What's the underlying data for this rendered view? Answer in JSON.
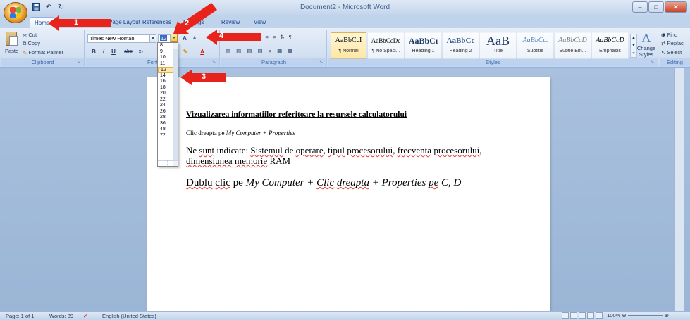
{
  "window": {
    "title": "Document2 - Microsoft Word",
    "minimize": "–",
    "maximize": "□",
    "close": "✕"
  },
  "quick_access": {
    "save_icon": "floppy-icon",
    "undo_glyph": "↶",
    "redo_glyph": "↻"
  },
  "tabs": [
    {
      "label": "Home",
      "active": true
    },
    {
      "label": "Page Layout"
    },
    {
      "label": "References"
    },
    {
      "label": "Mailings"
    },
    {
      "label": "Review"
    },
    {
      "label": "View"
    }
  ],
  "ribbon": {
    "clipboard": {
      "label": "Clipboard",
      "paste": "Paste",
      "cut": "Cut",
      "copy": "Copy",
      "format_painter": "Format Painter"
    },
    "font": {
      "label": "Font",
      "font_name": "Times New Roman",
      "font_size": "12",
      "bold": "B",
      "italic": "I",
      "underline": "U",
      "strikethrough": "abe",
      "subscript": "x₂",
      "grow": "A",
      "shrink": "A"
    },
    "paragraph": {
      "label": "Paragraph"
    },
    "styles": {
      "label": "Styles",
      "items": [
        {
          "preview": "AaBbCcI",
          "name": "¶ Normal",
          "selected": true
        },
        {
          "preview": "AaBbCcDc",
          "name": "¶ No Spaci..."
        },
        {
          "preview": "AaBbCı",
          "name": "Heading 1"
        },
        {
          "preview": "AaBbCc",
          "name": "Heading 2"
        },
        {
          "preview": "AaB",
          "name": "Title"
        },
        {
          "preview": "AaBbCc.",
          "name": "Subtitle"
        },
        {
          "preview": "AaBbCcD",
          "name": "Subtle Em..."
        },
        {
          "preview": "AaBbCcD",
          "name": "Emphasis"
        }
      ],
      "change_styles_1": "Change",
      "change_styles_2": "Styles"
    },
    "editing": {
      "label": "Editing",
      "find": "Find",
      "replace": "Replac",
      "select": "Select"
    }
  },
  "font_size_list": [
    "8",
    "9",
    "10",
    "11",
    "12",
    "14",
    "16",
    "18",
    "20",
    "22",
    "24",
    "26",
    "28",
    "36",
    "48",
    "72"
  ],
  "font_size_highlighted": "12",
  "document": {
    "heading": "Vizualizarea informatiilor referitoare la resursele calculatorului",
    "line2_prefix": "Clic dreapta pe ",
    "line2_italic": "My Computer + Properties",
    "para_1": "Ne ",
    "para_sunt": "sunt",
    "para_2": " indicate: ",
    "para_sistemul": "Sistemul",
    "para_3": " de ",
    "para_operare": "operare",
    "para_4": ", ",
    "para_tipul": "tipul",
    "para_5": " ",
    "para_procesorului": "procesorului",
    "para_6": ", ",
    "para_frecventa": "frecventa",
    "para_7": " ",
    "para_procesorului2": "procesorului",
    "para_8": ", ",
    "para_dimensiunea": "dimensiunea",
    "para_9": " ",
    "para_memorie": "memorie",
    "para_10": " RAM",
    "line4_a": "Dublu",
    "line4_b": " ",
    "line4_c": "clic",
    "line4_d": " pe ",
    "line4_e": "My Computer + ",
    "line4_f": "Clic",
    "line4_g": " ",
    "line4_h": "dreapta",
    "line4_i": " + Properties ",
    "line4_j": "pe",
    "line4_k": " C, D"
  },
  "callouts": [
    "1",
    "2",
    "3",
    "4"
  ],
  "statusbar": {
    "page": "Page: 1 of 1",
    "words": "Words: 39",
    "language": "English (United States)",
    "zoom": "100%"
  },
  "colors": {
    "callout_red": "#e8231b",
    "ribbon_blue": "#d5e2f3",
    "doc_bg": "#a9c1de"
  }
}
